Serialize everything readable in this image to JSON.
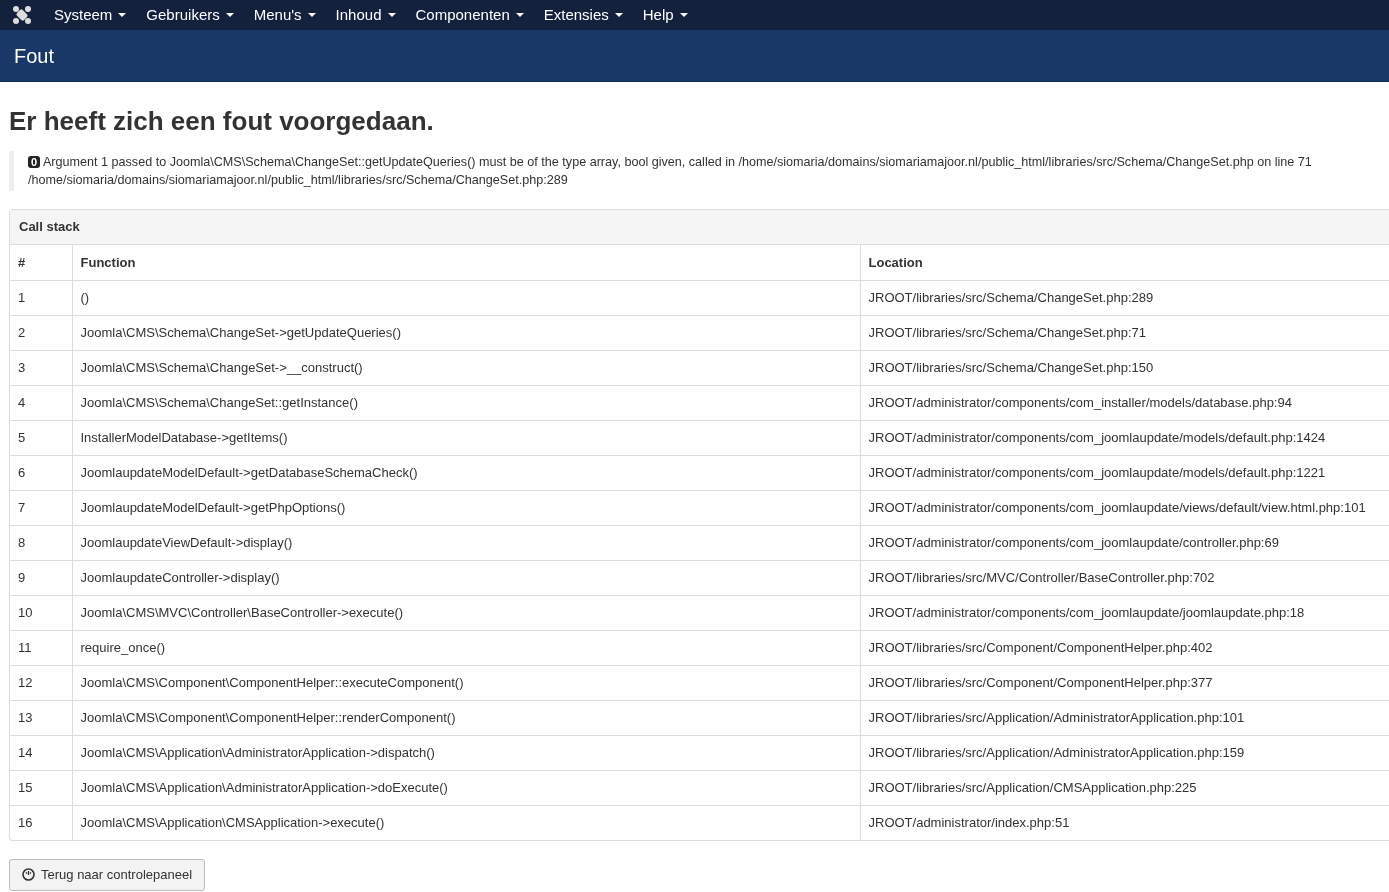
{
  "menu": [
    {
      "label": "Systeem"
    },
    {
      "label": "Gebruikers"
    },
    {
      "label": "Menu's"
    },
    {
      "label": "Inhoud"
    },
    {
      "label": "Componenten"
    },
    {
      "label": "Extensies"
    },
    {
      "label": "Help"
    }
  ],
  "page_title": "Fout",
  "heading": "Er heeft zich een fout voorgedaan.",
  "error": {
    "code": "0",
    "message": "Argument 1 passed to Joomla\\CMS\\Schema\\ChangeSet::getUpdateQueries() must be of the type array, bool given, called in /home/siomaria/domains/siomariamajoor.nl/public_html/libraries/src/Schema/ChangeSet.php on line 71",
    "location": "/home/siomaria/domains/siomariamajoor.nl/public_html/libraries/src/Schema/ChangeSet.php:289"
  },
  "call_stack": {
    "title": "Call stack",
    "columns": [
      "#",
      "Function",
      "Location"
    ],
    "rows": [
      [
        "1",
        "()",
        "JROOT/libraries/src/Schema/ChangeSet.php:289"
      ],
      [
        "2",
        "Joomla\\CMS\\Schema\\ChangeSet->getUpdateQueries()",
        "JROOT/libraries/src/Schema/ChangeSet.php:71"
      ],
      [
        "3",
        "Joomla\\CMS\\Schema\\ChangeSet->__construct()",
        "JROOT/libraries/src/Schema/ChangeSet.php:150"
      ],
      [
        "4",
        "Joomla\\CMS\\Schema\\ChangeSet::getInstance()",
        "JROOT/administrator/components/com_installer/models/database.php:94"
      ],
      [
        "5",
        "InstallerModelDatabase->getItems()",
        "JROOT/administrator/components/com_joomlaupdate/models/default.php:1424"
      ],
      [
        "6",
        "JoomlaupdateModelDefault->getDatabaseSchemaCheck()",
        "JROOT/administrator/components/com_joomlaupdate/models/default.php:1221"
      ],
      [
        "7",
        "JoomlaupdateModelDefault->getPhpOptions()",
        "JROOT/administrator/components/com_joomlaupdate/views/default/view.html.php:101"
      ],
      [
        "8",
        "JoomlaupdateViewDefault->display()",
        "JROOT/administrator/components/com_joomlaupdate/controller.php:69"
      ],
      [
        "9",
        "JoomlaupdateController->display()",
        "JROOT/libraries/src/MVC/Controller/BaseController.php:702"
      ],
      [
        "10",
        "Joomla\\CMS\\MVC\\Controller\\BaseController->execute()",
        "JROOT/administrator/components/com_joomlaupdate/joomlaupdate.php:18"
      ],
      [
        "11",
        "require_once()",
        "JROOT/libraries/src/Component/ComponentHelper.php:402"
      ],
      [
        "12",
        "Joomla\\CMS\\Component\\ComponentHelper::executeComponent()",
        "JROOT/libraries/src/Component/ComponentHelper.php:377"
      ],
      [
        "13",
        "Joomla\\CMS\\Component\\ComponentHelper::renderComponent()",
        "JROOT/libraries/src/Application/AdministratorApplication.php:101"
      ],
      [
        "14",
        "Joomla\\CMS\\Application\\AdministratorApplication->dispatch()",
        "JROOT/libraries/src/Application/AdministratorApplication.php:159"
      ],
      [
        "15",
        "Joomla\\CMS\\Application\\AdministratorApplication->doExecute()",
        "JROOT/libraries/src/Application/CMSApplication.php:225"
      ],
      [
        "16",
        "Joomla\\CMS\\Application\\CMSApplication->execute()",
        "JROOT/administrator/index.php:51"
      ]
    ]
  },
  "back_button": "Terug naar controlepaneel"
}
